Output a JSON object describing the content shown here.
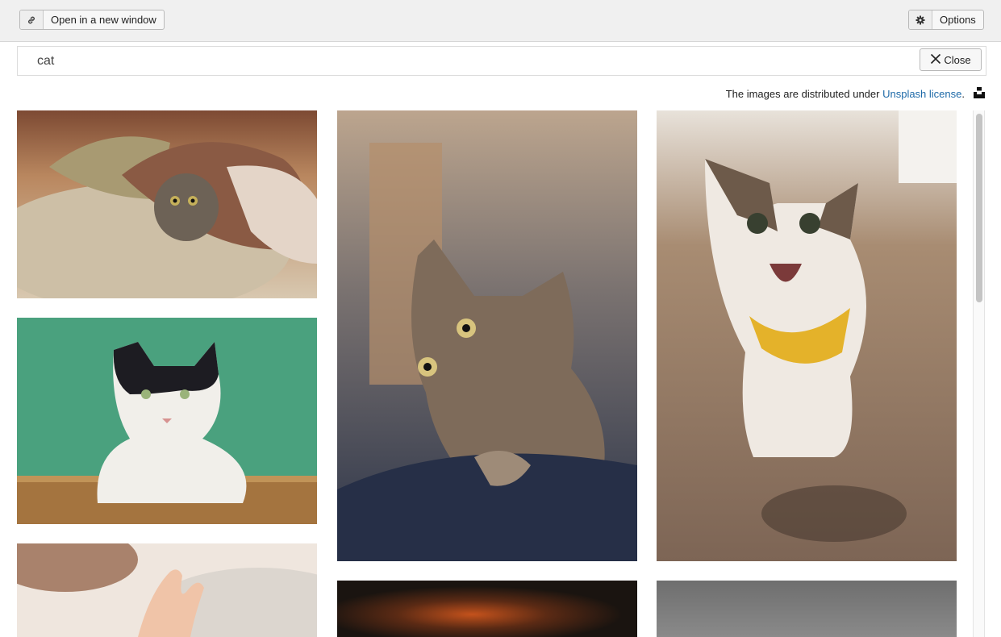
{
  "toolbar": {
    "open_window_label": "Open in a new window",
    "open_window_icon": "link-icon",
    "options_label": "Options",
    "options_icon": "gear-icon"
  },
  "search": {
    "value": "cat",
    "close_label": "Close",
    "close_icon": "close-icon"
  },
  "license": {
    "prefix": "The images are distributed under ",
    "link_text": "Unsplash license",
    "suffix": ".",
    "link_color": "#1e6aa8",
    "logo_icon": "unsplash-logo-icon"
  },
  "results": [
    {
      "subject": "tabby cat under blanket",
      "palette": "warm beige"
    },
    {
      "subject": "black and white cat on green background",
      "palette": "teal green"
    },
    {
      "subject": "hand with cat",
      "palette": "cream"
    },
    {
      "subject": "tabby cat looking up",
      "palette": "grey blue"
    },
    {
      "subject": "dark blurred photo",
      "palette": "dark orange"
    },
    {
      "subject": "happy cat with yellow bandana",
      "palette": "wood brown"
    },
    {
      "subject": "grey photo",
      "palette": "grey"
    }
  ]
}
